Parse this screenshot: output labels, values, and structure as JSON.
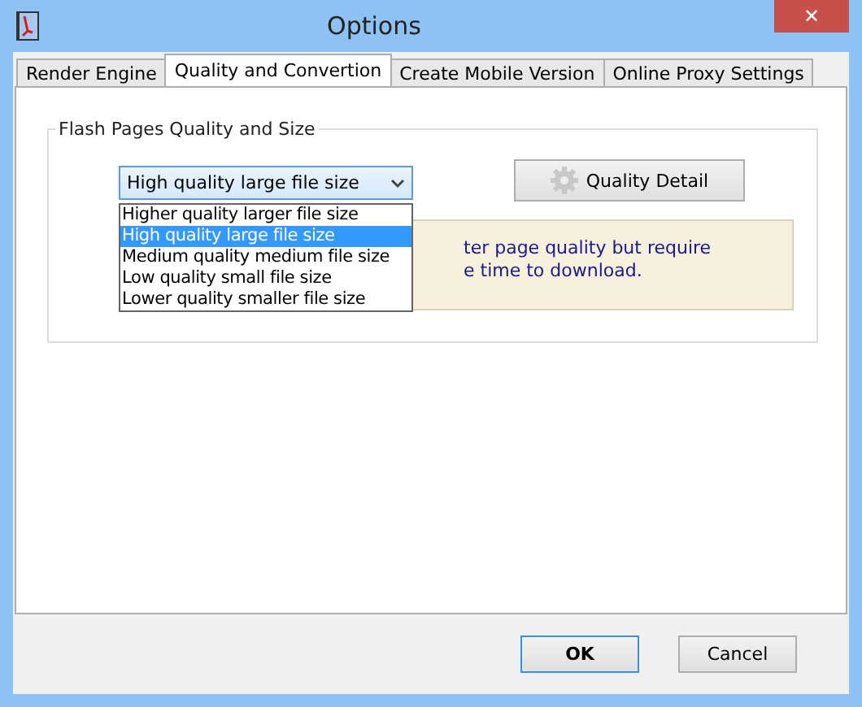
{
  "window": {
    "title": "Options",
    "close": "✕"
  },
  "tabs": [
    {
      "label": "Render Engine",
      "selected": false
    },
    {
      "label": "Quality and Convertion",
      "selected": true
    },
    {
      "label": "Create Mobile Version",
      "selected": false
    },
    {
      "label": "Online Proxy Settings",
      "selected": false
    }
  ],
  "group": {
    "title": "Flash Pages Quality and Size",
    "dropdown": {
      "value": "High quality large file size",
      "expanded": true,
      "options": [
        {
          "label": "Higher quality larger file size",
          "selected": false
        },
        {
          "label": "High quality large file size",
          "selected": true
        },
        {
          "label": "Medium quality medium file size",
          "selected": false
        },
        {
          "label": "Low quality small file size",
          "selected": false
        },
        {
          "label": "Lower quality smaller file size",
          "selected": false
        }
      ]
    },
    "detail_button": "Quality Detail",
    "info_lines": [
      "ter page quality but require",
      "e time to download."
    ]
  },
  "buttons": [
    {
      "label": "OK",
      "default": true
    },
    {
      "label": "Cancel",
      "default": false
    }
  ]
}
